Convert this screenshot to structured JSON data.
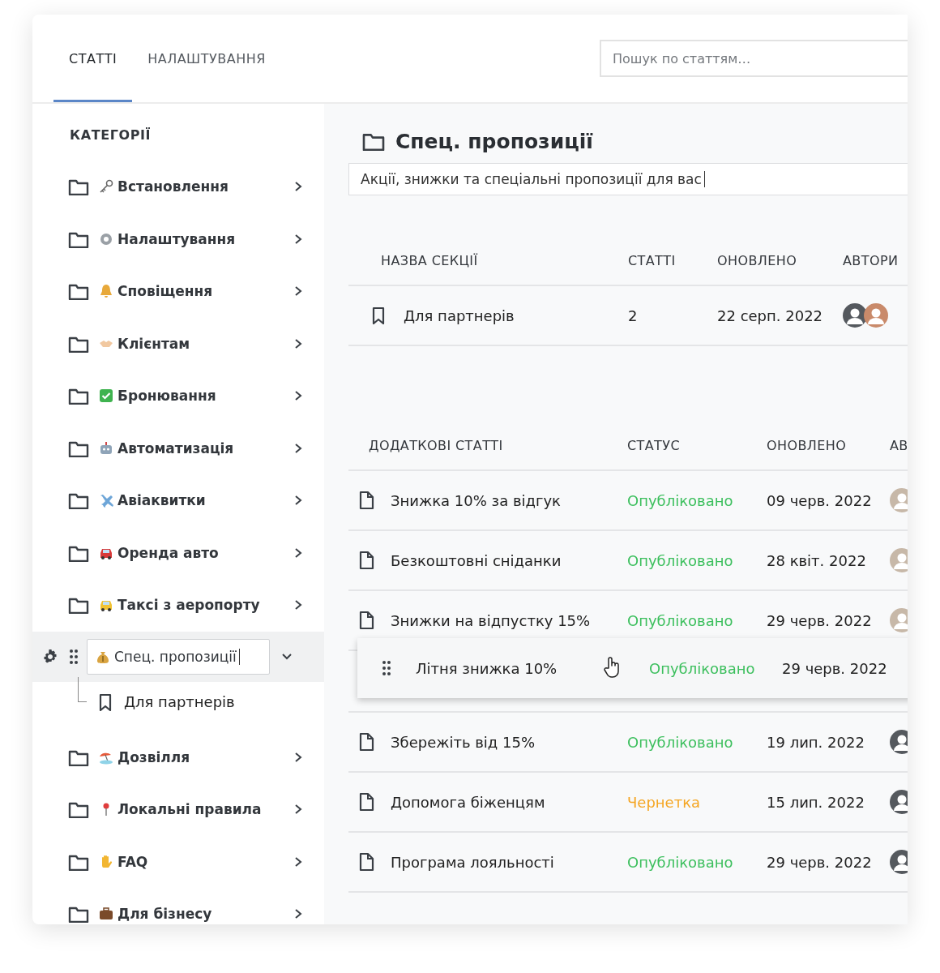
{
  "tabs": [
    {
      "label": "СТАТТІ",
      "selected": true
    },
    {
      "label": "НАЛАШТУВАННЯ",
      "selected": false
    }
  ],
  "search": {
    "placeholder": "Пошук по статтям…"
  },
  "sidebar": {
    "heading": "КАТЕГОРІЇ",
    "items": [
      {
        "label": "Встановлення",
        "selected": false,
        "expanded": false
      },
      {
        "label": "Налаштування",
        "selected": false,
        "expanded": false
      },
      {
        "label": "Сповіщення",
        "selected": false,
        "expanded": false
      },
      {
        "label": "Клієнтам",
        "selected": false,
        "expanded": false
      },
      {
        "label": "Бронювання",
        "selected": false,
        "expanded": false
      },
      {
        "label": "Автоматизація",
        "selected": false,
        "expanded": false
      },
      {
        "label": "Авіаквитки",
        "selected": false,
        "expanded": false
      },
      {
        "label": "Оренда авто",
        "selected": false,
        "expanded": false
      },
      {
        "label": "Таксі з аеропорту",
        "selected": false,
        "expanded": false
      },
      {
        "label": "Спец. пропозиції",
        "selected": true,
        "expanded": true,
        "children": [
          {
            "label": "Для партнерів"
          }
        ]
      },
      {
        "label": "Дозвілля",
        "selected": false,
        "expanded": false
      },
      {
        "label": "Локальні правила",
        "selected": false,
        "expanded": false
      },
      {
        "label": "FAQ",
        "selected": false,
        "expanded": false
      },
      {
        "label": "Для бізнесу",
        "selected": false,
        "expanded": false
      }
    ]
  },
  "main": {
    "title": "Спец. пропозиції",
    "description": {
      "value": "Акції, знижки та спеціальні пропозиції для вас"
    },
    "sections_table": {
      "columns": [
        "НАЗВА СЕКЦІЇ",
        "СТАТТІ",
        "ОНОВЛЕНО",
        "АВТОРИ"
      ],
      "rows": [
        {
          "name": "Для партнерів",
          "articles": "2",
          "updated": "22 серп. 2022"
        }
      ]
    },
    "articles_table": {
      "columns": [
        "ДОДАТКОВІ СТАТТІ",
        "СТАТУС",
        "ОНОВЛЕНО",
        "АВ"
      ],
      "rows": [
        {
          "title": "Знижка 10% за відгук",
          "status": "Опубліковано",
          "kind": "published",
          "updated": "09 черв. 2022"
        },
        {
          "title": "Безкоштовні сніданки",
          "status": "Опубліковано",
          "kind": "published",
          "updated": "28 квіт. 2022"
        },
        {
          "title": "Знижки на відпустку 15%",
          "status": "Опубліковано",
          "kind": "published",
          "updated": "29 черв. 2022"
        },
        {
          "kind": "placeholder"
        },
        {
          "title": "Збережіть від 15%",
          "status": "Опубліковано",
          "kind": "published",
          "updated": "19 лип. 2022"
        },
        {
          "title": "Допомога біженцям",
          "status": "Чернетка",
          "kind": "draft",
          "updated": "15 лип. 2022"
        },
        {
          "title": "Програма лояльності",
          "status": "Опубліковано",
          "kind": "published",
          "updated": "29 черв. 2022"
        }
      ],
      "dragged_row": {
        "title": "Літня знижка 10%",
        "status": "Опубліковано",
        "kind": "published",
        "updated": "29 черв. 2022"
      }
    }
  }
}
